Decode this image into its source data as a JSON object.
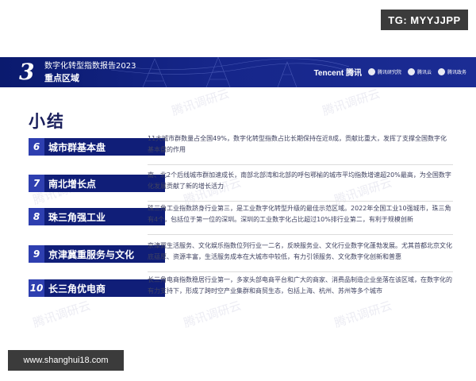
{
  "corner_tag": "TG: MYYJJPP",
  "header": {
    "chapter": "3",
    "report_title": "数字化转型指数报告2023",
    "section": "重点区域",
    "logos": [
      "Tencent 腾讯",
      "腾讯研究院",
      "腾讯云",
      "腾讯政务"
    ]
  },
  "page_title": "小结",
  "watermark": "腾讯调研云",
  "items": [
    {
      "num": "6",
      "label": "城市群基本盘",
      "text": "11大城市群数量占全国49%，数字化转型指数占比长期保持在近8成，贡献比重大，发挥了支撑全国数字化基本盘的作用"
    },
    {
      "num": "7",
      "label": "南北增长点",
      "text": "南、北2个后线城市群加速成长，南部北部湾和北部的呼包鄂榆的城市平均指数增速超20%最高，为全国数字化发展贡献了新的增长活力"
    },
    {
      "num": "8",
      "label": "珠三角强工业",
      "text": "珠三角工业指数跻身行业第三，是工业数字化转型升级的最佳示范区域。2022年全国工业10强城市，珠三角有4个，包括位于第一位的深圳。深圳的工业数字化占比超过10%排行业第二，有利于规模创新"
    },
    {
      "num": "9",
      "label": "京津冀重服务与文化",
      "text": "京津冀生活服务、文化娱乐指数位列行业一二名，反映服务业、文化行业数字化蓬勃发展。尤其首都北京文化底蕴厚、资源丰富，生活服务成本在大城市中较低，有力引领服务、文化数字化创新和普惠"
    },
    {
      "num": "10",
      "label": "长三角优电商",
      "text": "长三角电商指数稳居行业第一，多家头部电商平台和广大的商家、消费品制造企业坐落在该区域，在数字化的有力支持下，形成了跨时空产业集群和商贸生态，包括上海、杭州、苏州等多个城市"
    }
  ],
  "footer_tag": "www.shanghui18.com"
}
